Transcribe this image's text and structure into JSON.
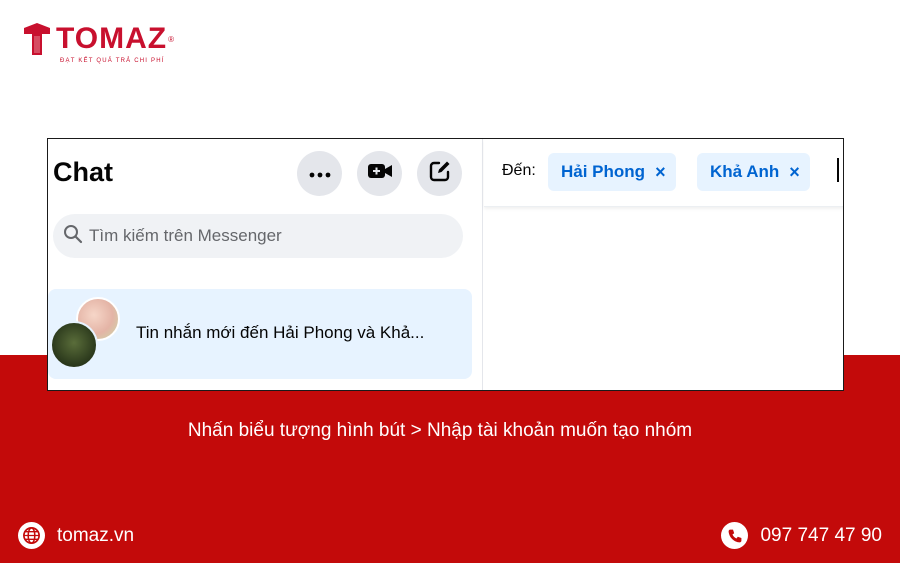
{
  "brand": {
    "name": "TOMAZ",
    "registered": "®",
    "tagline": "ĐẠT KẾT QUẢ TRẢ CHI PHÍ"
  },
  "messenger": {
    "title": "Chat",
    "icons": [
      "more-icon",
      "video-add-icon",
      "new-message-icon",
      "search-icon",
      "close-icon"
    ],
    "search_placeholder": "Tìm kiếm trên Messenger",
    "conversation": {
      "text": "Tin nhắn mới đến Hải Phong và Khả..."
    },
    "to": {
      "label": "Đến:",
      "recipients": [
        {
          "name": "Hải Phong",
          "remove": "×"
        },
        {
          "name": "Khả Anh",
          "remove": "×"
        }
      ]
    }
  },
  "caption": "Nhấn biểu tượng hình bút > Nhập tài khoản muốn tạo nhóm",
  "footer": {
    "website": "tomaz.vn",
    "phone": "097 747 47 90"
  },
  "colors": {
    "brand_red": "#c30a0a",
    "messenger_blue": "#0064d1",
    "chip_bg": "#e7f3ff"
  }
}
